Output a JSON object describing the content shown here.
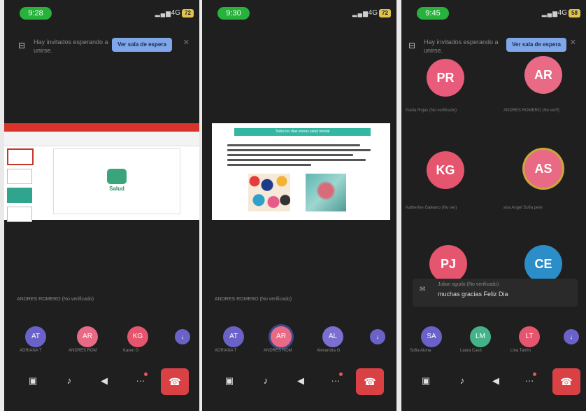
{
  "phones": [
    {
      "time": "9:28",
      "network": "4G",
      "battery": "72",
      "notice": {
        "text": "Hay invitados esperando a unirse.",
        "button": "Ver sala de espera"
      },
      "share_caption": "ANDRES ROMERO (No verificado)",
      "share_logo_text": "Salud",
      "participants": [
        {
          "initials": "AT",
          "name": "ADRIANA T",
          "color": "#6a62c9"
        },
        {
          "initials": "AR",
          "name": "ANDRES ROM",
          "color": "#e96a85"
        },
        {
          "initials": "KG",
          "name": "Karen G",
          "color": "#e5566e"
        }
      ],
      "more_label": "↓"
    },
    {
      "time": "9:30",
      "network": "4G",
      "battery": "72",
      "share_caption": "ANDRES ROMERO (No verificado)",
      "doc_title": "Todos los días somos salud mental",
      "participants": [
        {
          "initials": "AT",
          "name": "ADRIANA T",
          "color": "#6a62c9"
        },
        {
          "initials": "AR",
          "name": "ANDRES ROM",
          "color": "#e96a85"
        },
        {
          "initials": "AL",
          "name": "Alexandra G",
          "color": "#7b6fd1"
        }
      ],
      "more_label": "↓"
    },
    {
      "time": "9:45",
      "network": "4G",
      "battery": "58",
      "notice": {
        "text": "Hay invitados esperando a unirse.",
        "button": "Ver sala de espera"
      },
      "grid": [
        {
          "initials": "PR",
          "name": "Paola Rojas (No verificado)",
          "color": "#e85b7a"
        },
        {
          "initials": "AR",
          "name": "ANDRES ROMERO (No verif)",
          "color": "#e96a85"
        },
        {
          "initials": "KG",
          "name": "Katherine Galeano (No ver)",
          "color": "#e5566e"
        },
        {
          "initials": "AS",
          "name": "ana Angel Sofia pere",
          "color": "#e96a85"
        },
        {
          "initials": "PJ",
          "name": "",
          "color": "#e5566e"
        },
        {
          "initials": "CE",
          "name": "",
          "color": "#2b8ec9"
        }
      ],
      "chat": {
        "author": "Julian agudo (No verificado)",
        "message": "muchas gracias Feliz Dia"
      },
      "participants": [
        {
          "initials": "SA",
          "name": "Sofia Aluna",
          "color": "#6a62c9"
        },
        {
          "initials": "LM",
          "name": "Laura Casti",
          "color": "#44b38a"
        },
        {
          "initials": "LT",
          "name": "Lina Tamin",
          "color": "#e5566e"
        }
      ],
      "more_label": "↓"
    }
  ]
}
